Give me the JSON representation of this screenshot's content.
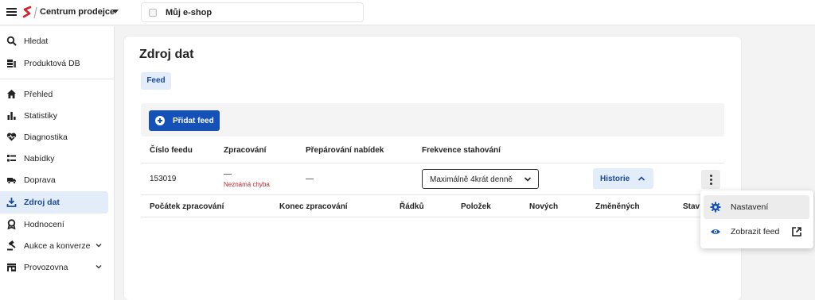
{
  "topbar": {
    "app_title": "Centrum prodejce",
    "shop_name": "Můj e-shop"
  },
  "sidebar": {
    "items": [
      {
        "label": "Hledat",
        "icon": "search-icon"
      },
      {
        "label": "Produktová DB",
        "icon": "database-icon"
      },
      {
        "label": "Přehled",
        "icon": "home-icon"
      },
      {
        "label": "Statistiky",
        "icon": "bar-chart-icon"
      },
      {
        "label": "Diagnostika",
        "icon": "heart-pulse-icon"
      },
      {
        "label": "Nabídky",
        "icon": "list-icon"
      },
      {
        "label": "Doprava",
        "icon": "truck-icon"
      },
      {
        "label": "Zdroj dat",
        "icon": "download-icon",
        "active": true
      },
      {
        "label": "Hodnocení",
        "icon": "rating-icon"
      },
      {
        "label": "Aukce a konverze",
        "icon": "gavel-icon"
      },
      {
        "label": "Provozovna",
        "icon": "store-icon"
      }
    ]
  },
  "page": {
    "title": "Zdroj dat",
    "tab": "Feed",
    "add_button": "Přidat feed"
  },
  "table": {
    "headers": [
      "Číslo feedu",
      "Zpracování",
      "Přepárování nabídek",
      "Frekvence stahování"
    ],
    "row": {
      "feed_number": "153019",
      "processing": "—",
      "processing_error": "Neznámá chyba",
      "pairing": "—",
      "frequency": "Maximálně 4krát denně",
      "history_button": "Historie"
    },
    "sub_headers": [
      "Počátek zpracování",
      "Konec zpracování",
      "Řádků",
      "Položek",
      "Nových",
      "Změněných",
      "Stav"
    ]
  },
  "menu": {
    "items": [
      {
        "label": "Nastavení",
        "icon": "gear-icon"
      },
      {
        "label": "Zobrazit feed",
        "icon": "eye-icon"
      }
    ]
  },
  "colors": {
    "primary": "#1451b8",
    "active_bg": "#e3ecf9",
    "active_text": "#1a4b9b",
    "error": "#c0262d",
    "brand_red": "#d6202a"
  }
}
